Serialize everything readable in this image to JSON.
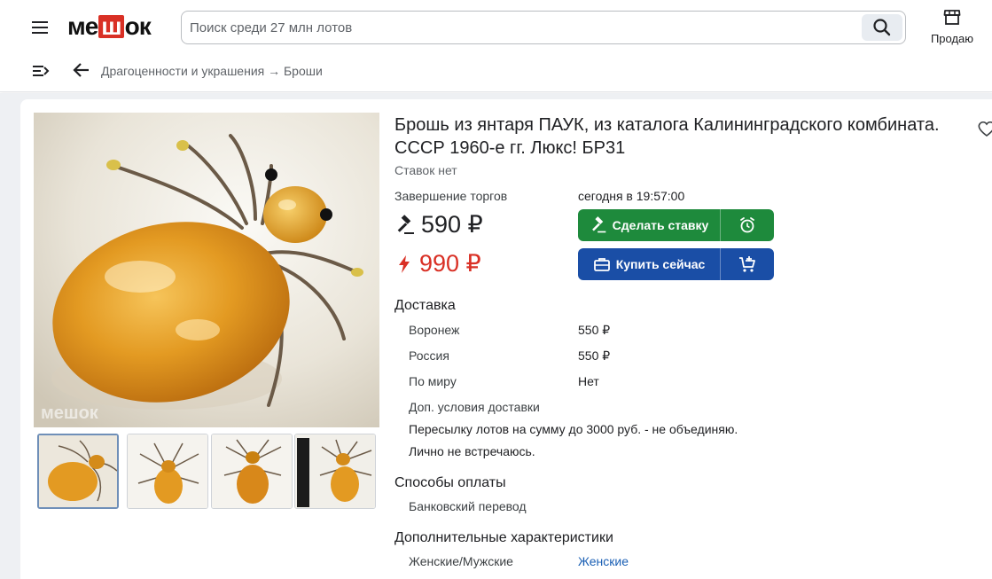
{
  "header": {
    "logo_text_left": "ме",
    "logo_text_mid": "ш",
    "logo_text_right": "ок",
    "search_placeholder": "Поиск среди 27 млн лотов",
    "sell_label": "Продаю"
  },
  "breadcrumb": "Драгоценности и украшения → Броши",
  "lot": {
    "title": "Брошь из янтаря ПАУК, из каталога Калининградского комбината. СССР 1960-е гг. Люкс! БР31",
    "bids": "Ставок нет",
    "end_label": "Завершение торгов",
    "end_value": "сегодня в 19:57:00",
    "current_price": "590 ₽",
    "buy_price": "990 ₽",
    "bid_button": "Сделать ставку",
    "buy_button": "Купить сейчас",
    "watermark": "мешок"
  },
  "delivery": {
    "heading": "Доставка",
    "rows": [
      {
        "label": "Воронеж",
        "value": "550 ₽"
      },
      {
        "label": "Россия",
        "value": "550 ₽"
      },
      {
        "label": "По миру",
        "value": "Нет"
      }
    ],
    "extra_label": "Доп. условия доставки",
    "notes": [
      "Пересылку лотов на сумму до 3000 руб. - не объединяю.",
      "Лично не встречаюсь."
    ]
  },
  "payment": {
    "heading": "Способы оплаты",
    "method": "Банковский перевод"
  },
  "characteristics": {
    "heading": "Дополнительные характеристики",
    "rows": [
      {
        "label": "Женские/Мужские",
        "value": "Женские"
      }
    ]
  },
  "colors": {
    "bid_green": "#1e8a3c",
    "buy_blue": "#1a4ea6",
    "price_red": "#d93025",
    "link_blue": "#1a5fb4"
  }
}
